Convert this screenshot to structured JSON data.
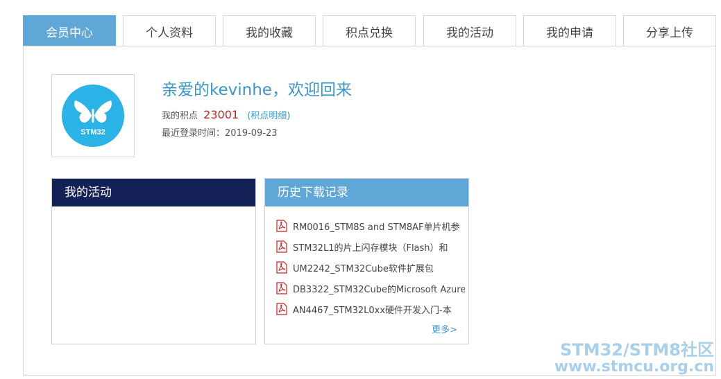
{
  "tabs": [
    {
      "label": "会员中心",
      "active": true
    },
    {
      "label": "个人资料"
    },
    {
      "label": "我的收藏"
    },
    {
      "label": "积点兑换"
    },
    {
      "label": "我的活动"
    },
    {
      "label": "我的申请"
    },
    {
      "label": "分享上传"
    }
  ],
  "avatar": {
    "logo_text": "STM32"
  },
  "profile": {
    "greeting": "亲爱的kevinhe，欢迎回来",
    "points_label": "我的积点",
    "points_value": "23001",
    "points_detail": "(积点明细)",
    "last_login": "最近登录时间：2019-09-23"
  },
  "activity_box": {
    "title": "我的活动"
  },
  "downloads_box": {
    "title": "历史下载记录",
    "items": [
      "RM0016_STM8S and STM8AF单片机参",
      "STM32L1的片上闪存模块（Flash）和",
      "UM2242_STM32Cube软件扩展包",
      "DB3322_STM32Cube的Microsoft Azure",
      "AN4467_STM32L0xx硬件开发入门-本"
    ],
    "more": "更多>"
  },
  "watermark": {
    "line1": "STM32/STM8社区",
    "line2": "www.stmcu.org.cn"
  },
  "colors": {
    "tab_active": "#5ea7d6",
    "activity_header": "#142156",
    "link": "#3a95c9",
    "points": "#c62121"
  }
}
